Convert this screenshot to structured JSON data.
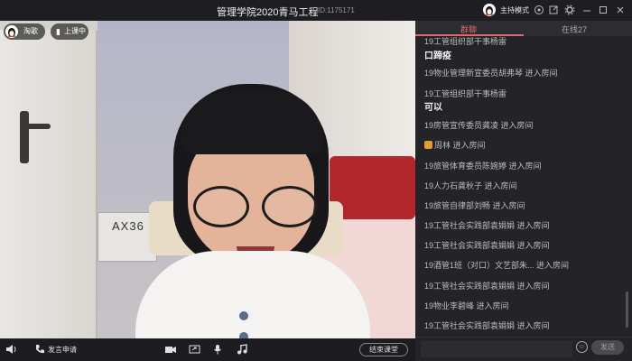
{
  "window": {
    "title": "管理学院2020青马工程",
    "room_id": "ID:1175171",
    "mode_label": "主持模式"
  },
  "video_overlay": {
    "teacher_name": "淘歌",
    "class_label": "上课中"
  },
  "bottom_bar": {
    "speak_label": "发言申请",
    "end_label": "结束课堂"
  },
  "chat": {
    "tabs": [
      {
        "label": "群聊",
        "active": true
      },
      {
        "label": "在线27",
        "active": false
      }
    ],
    "messages": [
      {
        "type": "sender",
        "text": "19工管组织部干事杨雷"
      },
      {
        "type": "content",
        "text": "口蹄疫"
      },
      {
        "type": "join",
        "text": "19物业管理新宣委员胡弗琴 进入房间"
      },
      {
        "type": "sender",
        "text": "19工管组织部干事杨雷"
      },
      {
        "type": "content",
        "text": "可以"
      },
      {
        "type": "join",
        "text": "19房管宣传委员龚凌 进入房间"
      },
      {
        "type": "join",
        "text": "周林 进入房间",
        "badge": true
      },
      {
        "type": "join",
        "text": "19旅管体育委员陈婉婷 进入房间"
      },
      {
        "type": "join",
        "text": "19人力石龚秋子 进入房间"
      },
      {
        "type": "join",
        "text": "19旅管自律部刘畅 进入房间"
      },
      {
        "type": "join",
        "text": "19工管社会实践部袁娟娟 进入房间"
      },
      {
        "type": "join",
        "text": "19工管社会实践部袁娟娟 进入房间"
      },
      {
        "type": "join",
        "text": "19酒管1班（对口）文艺部朱... 进入房间"
      },
      {
        "type": "join",
        "text": "19工管社会实践部袁娟娟 进入房间"
      },
      {
        "type": "join",
        "text": "19物业李碧峰 进入房间"
      },
      {
        "type": "join",
        "text": "19工管社会实践部袁娟娟 进入房间"
      }
    ],
    "input_placeholder": "",
    "send_label": "发送"
  },
  "scene": {
    "router_text": "AX36"
  },
  "icons": {
    "avatar": "qq-penguin-icon",
    "skin": "skin-icon",
    "settings": "gear-icon",
    "fullscreen": "fullscreen-icon",
    "minimize": "minimize-icon",
    "maximize": "maximize-icon",
    "close": "close-icon",
    "speaker": "speaker-icon",
    "phone": "phone-icon",
    "camera": "camera-icon",
    "screen_share": "screen-share-icon",
    "microphone": "microphone-icon",
    "music": "music-icon",
    "emoji": "emoji-icon"
  },
  "colors": {
    "accent": "#e8646b",
    "background": "#1b1b1f",
    "panel": "#242428"
  }
}
